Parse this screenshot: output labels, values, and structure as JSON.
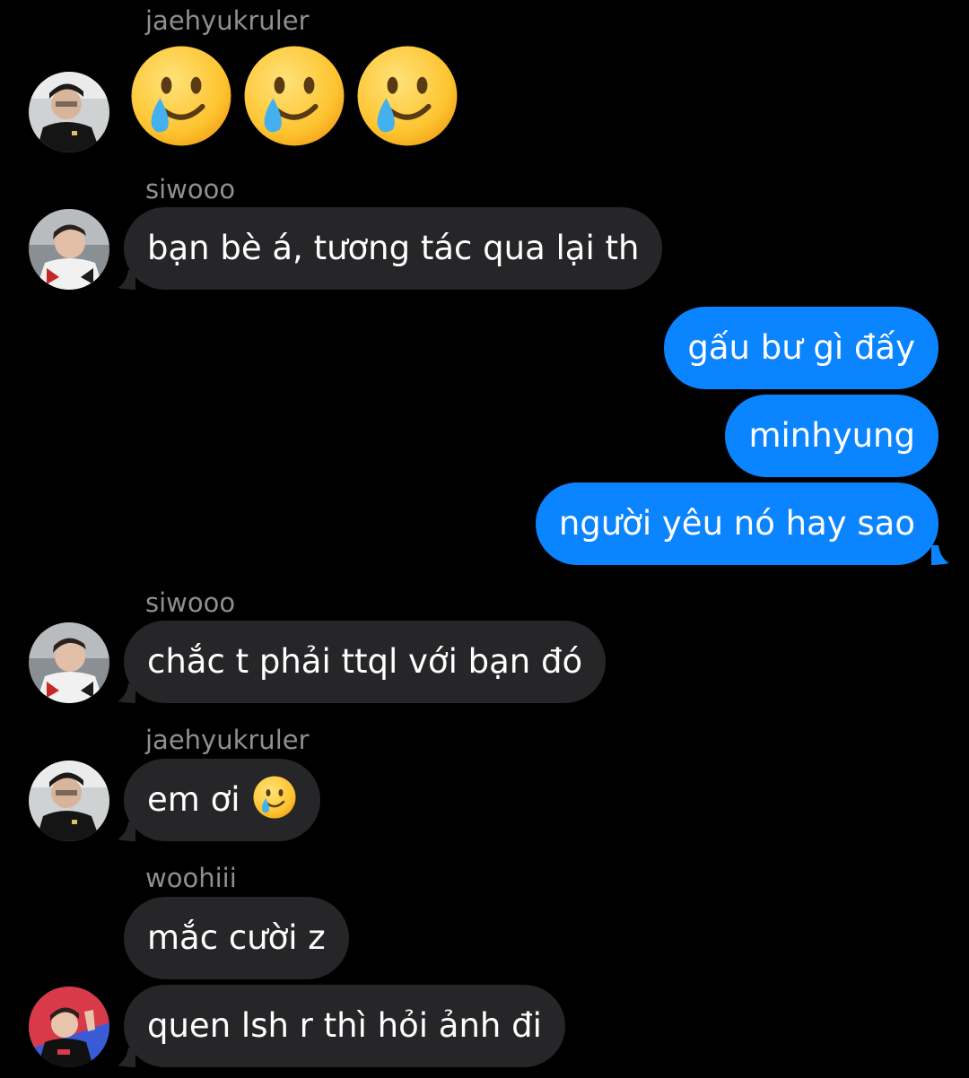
{
  "thread": {
    "messages": [
      {
        "sender": "jaehyukruler",
        "type": "emoji",
        "emoji": "smiling-face-with-tear-icon",
        "count": 3
      },
      {
        "sender": "siwooo",
        "text": "bạn bè á, tương tác qua lại th"
      },
      {
        "sender": "me",
        "text": "gấu bư gì đấy"
      },
      {
        "sender": "me",
        "text": "minhyung"
      },
      {
        "sender": "me",
        "text": "người yêu nó hay sao"
      },
      {
        "sender": "siwooo",
        "text": "chắc t phải ttql với bạn đó"
      },
      {
        "sender": "jaehyukruler",
        "text": "em ơi",
        "trailing_emoji": "smiling-face-with-tear-icon"
      },
      {
        "sender": "woohiii",
        "text": "mắc cười z"
      },
      {
        "sender": "woohiii",
        "text": "quen lsh r thì hỏi ảnh đi"
      }
    ]
  },
  "colors": {
    "background": "#000000",
    "incoming_bubble": "#262628",
    "outgoing_bubble": "#0a84ff",
    "sender_label": "#8e8e93",
    "text": "#ffffff"
  }
}
